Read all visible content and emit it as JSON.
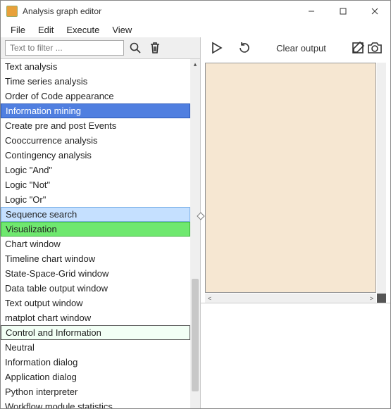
{
  "title": "Analysis graph editor",
  "menu": {
    "file": "File",
    "edit": "Edit",
    "execute": "Execute",
    "view": "View"
  },
  "filter": {
    "placeholder": "Text to filter ..."
  },
  "canvas": {
    "clear": "Clear output"
  },
  "list": {
    "items": [
      {
        "label": "Text analysis",
        "cls": ""
      },
      {
        "label": "Time series analysis",
        "cls": ""
      },
      {
        "label": "Order of Code appearance",
        "cls": ""
      },
      {
        "label": "Information mining",
        "cls": "hdr-blue"
      },
      {
        "label": "Create pre and post Events",
        "cls": ""
      },
      {
        "label": "Cooccurrence analysis",
        "cls": ""
      },
      {
        "label": "Contingency analysis",
        "cls": ""
      },
      {
        "label": "Logic \"And\"",
        "cls": ""
      },
      {
        "label": "Logic \"Not\"",
        "cls": ""
      },
      {
        "label": "Logic \"Or\"",
        "cls": ""
      },
      {
        "label": "Sequence search",
        "cls": "hdr-lightblue"
      },
      {
        "label": "Visualization",
        "cls": "hdr-green"
      },
      {
        "label": "Chart window",
        "cls": ""
      },
      {
        "label": "Timeline chart window",
        "cls": ""
      },
      {
        "label": "State-Space-Grid window",
        "cls": ""
      },
      {
        "label": "Data table output window",
        "cls": ""
      },
      {
        "label": "Text output window",
        "cls": ""
      },
      {
        "label": "matplot chart window",
        "cls": ""
      },
      {
        "label": "Control and Information",
        "cls": "hdr-mint"
      },
      {
        "label": "Neutral",
        "cls": ""
      },
      {
        "label": "Information dialog",
        "cls": ""
      },
      {
        "label": "Application dialog",
        "cls": ""
      },
      {
        "label": "Python interpreter",
        "cls": ""
      },
      {
        "label": "Workflow module statistics",
        "cls": ""
      }
    ]
  }
}
